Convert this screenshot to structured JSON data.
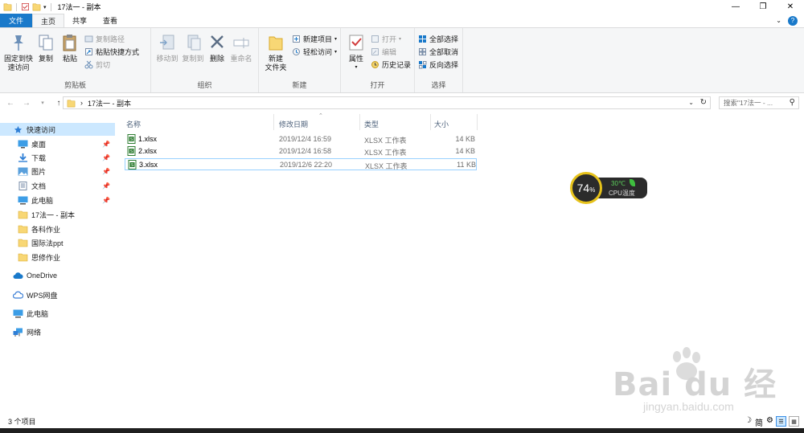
{
  "window": {
    "title": "17法一 - 副本",
    "controls": [
      "minimize-icon",
      "restore-icon",
      "close-icon"
    ]
  },
  "tabs": [
    {
      "label": "文件"
    },
    {
      "label": "主页"
    },
    {
      "label": "共享"
    },
    {
      "label": "查看"
    }
  ],
  "ribbon": {
    "clipboard": {
      "group_label": "剪贴板",
      "pin": "固定到快速访问",
      "pin_line1": "固定到快",
      "pin_line2": "速访问",
      "copy": "复制",
      "paste": "粘贴",
      "copy_path": "复制路径",
      "paste_shortcut": "粘贴快捷方式",
      "cut": "剪切"
    },
    "organize": {
      "group_label": "组织",
      "move_to": "移动到",
      "copy_to": "复制到",
      "delete": "删除",
      "rename": "重命名"
    },
    "new": {
      "group_label": "新建",
      "new_folder_line1": "新建",
      "new_folder_line2": "文件夹",
      "new_item": "新建项目",
      "easy_access": "轻松访问"
    },
    "open": {
      "group_label": "打开",
      "properties": "属性",
      "open": "打开",
      "edit": "编辑",
      "history": "历史记录"
    },
    "select": {
      "group_label": "选择",
      "select_all": "全部选择",
      "select_none": "全部取消",
      "invert": "反向选择"
    }
  },
  "address": {
    "path": "17法一 - 副本",
    "search_placeholder": "搜索\"17法一 - ..."
  },
  "nav": {
    "items": [
      {
        "label": "快速访问",
        "icon": "star-icon"
      },
      {
        "label": "桌面",
        "icon": "desktop-icon"
      },
      {
        "label": "下载",
        "icon": "download-icon"
      },
      {
        "label": "图片",
        "icon": "pictures-icon"
      },
      {
        "label": "文档",
        "icon": "documents-icon"
      },
      {
        "label": "此电脑",
        "icon": "computer-icon"
      },
      {
        "label": "17法一 - 副本",
        "icon": "folder-icon"
      },
      {
        "label": "各科作业",
        "icon": "folder-icon"
      },
      {
        "label": "国际法ppt",
        "icon": "folder-icon"
      },
      {
        "label": "思修作业",
        "icon": "folder-icon"
      },
      {
        "label": "OneDrive",
        "icon": "cloud-icon"
      },
      {
        "label": "WPS网盘",
        "icon": "wps-cloud-icon"
      },
      {
        "label": "此电脑",
        "icon": "computer-icon"
      },
      {
        "label": "网络",
        "icon": "network-icon"
      }
    ]
  },
  "columns": {
    "name": "名称",
    "date": "修改日期",
    "type": "类型",
    "size": "大小"
  },
  "files": [
    {
      "name": "1.xlsx",
      "date": "2019/12/4 16:59",
      "type": "XLSX 工作表",
      "size": "14 KB"
    },
    {
      "name": "2.xlsx",
      "date": "2019/12/4 16:58",
      "type": "XLSX 工作表",
      "size": "14 KB"
    },
    {
      "name": "3.xlsx",
      "date": "2019/12/6 22:20",
      "type": "XLSX 工作表",
      "size": "11 KB"
    }
  ],
  "cpu_widget": {
    "percent": "74",
    "percent_unit": "%",
    "temp": "30℃",
    "label": "CPU温度"
  },
  "status": {
    "count": "3 个项目"
  },
  "ime": {
    "moon": "☽",
    "mode": "简"
  },
  "watermark": {
    "brand": "Bai du 经验",
    "url": "jingyan.baidu.com"
  },
  "colors": {
    "accent": "#1979ca",
    "selection": "#cce8ff",
    "cpu_ring": "#e6c21a",
    "cpu_temp": "#5bd15b"
  }
}
